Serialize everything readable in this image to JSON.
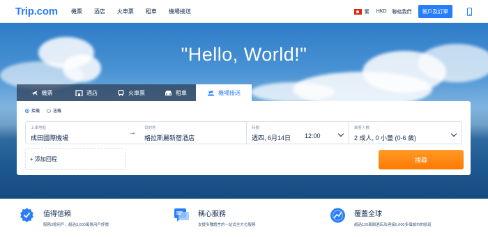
{
  "header": {
    "logo": "Trip.com",
    "nav": [
      "機票",
      "酒店",
      "火車票",
      "租車",
      "機場接送"
    ],
    "language": "繁",
    "currency": "HKD",
    "contact": "聯絡我們",
    "signin": "帳戶及訂單"
  },
  "hero": {
    "title": "\"Hello, World!\""
  },
  "tabs": [
    {
      "label": "機票",
      "icon": "plane-icon",
      "active": false
    },
    {
      "label": "酒店",
      "icon": "hotel-icon",
      "active": false
    },
    {
      "label": "火車票",
      "icon": "train-icon",
      "active": false
    },
    {
      "label": "租車",
      "icon": "car-icon",
      "active": false
    },
    {
      "label": "機場接送",
      "icon": "airport-transfer-icon",
      "active": true
    }
  ],
  "search": {
    "trip_types": [
      "接機",
      "送機"
    ],
    "selected_trip_type": "接機",
    "from": {
      "label": "上車地點",
      "value": "成田國際機場"
    },
    "to": {
      "label": "目的地",
      "value": "格拉斯麗新宿酒店"
    },
    "time": {
      "label": "時間",
      "date": "週四, 6月14日",
      "clock": "12:00"
    },
    "passengers": {
      "label": "乘客人數",
      "value": "2 成人, 0 小童 (0-6 歲)"
    },
    "add_return": "+ 添加回程",
    "search_button": "搜尋"
  },
  "features": [
    {
      "title": "值得信賴",
      "subtitle": "服務3億用戶，超過3,000萬條用戶評價",
      "icon": "trust-badge-icon"
    },
    {
      "title": "稱心服務",
      "subtitle": "支援多種語言的一站式全方位服務",
      "icon": "service-chat-icon"
    },
    {
      "title": "覆蓋全球",
      "subtitle": "超過120萬間酒店及連接5,000多個城市的航班",
      "icon": "global-coverage-icon"
    }
  ],
  "colors": {
    "brand": "#287dfa",
    "search_button": "#ff7a00",
    "text": "#0f294d"
  }
}
